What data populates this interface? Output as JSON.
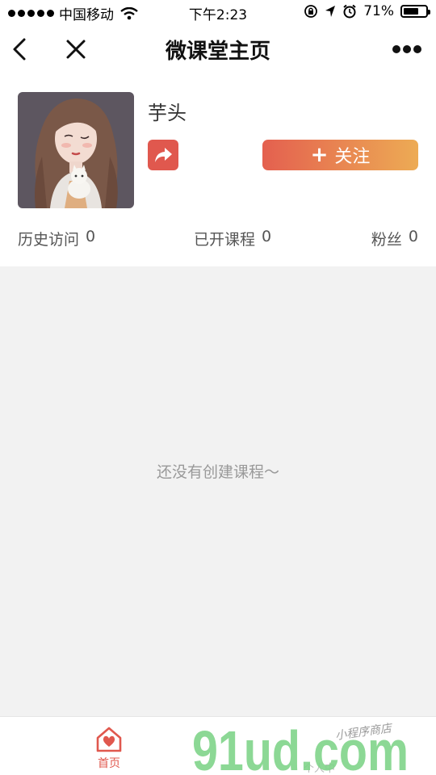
{
  "status_bar": {
    "carrier": "中国移动",
    "time": "下午2:23",
    "battery": "71%",
    "battery_level": 0.71
  },
  "nav": {
    "title": "微课堂主页"
  },
  "profile": {
    "name": "芋头",
    "follow_label": "关注"
  },
  "stats": [
    {
      "label": "历史访问",
      "value": "0"
    },
    {
      "label": "已开课程",
      "value": "0"
    },
    {
      "label": "粉丝",
      "value": "0"
    }
  ],
  "content": {
    "empty_message": "还没有创建课程～"
  },
  "tab_bar": {
    "home_label": "首页",
    "accent_color": "#e0584e"
  },
  "watermark": {
    "logo": "91ud.com",
    "caption": "小程序商店",
    "faint_label": "个人中"
  }
}
